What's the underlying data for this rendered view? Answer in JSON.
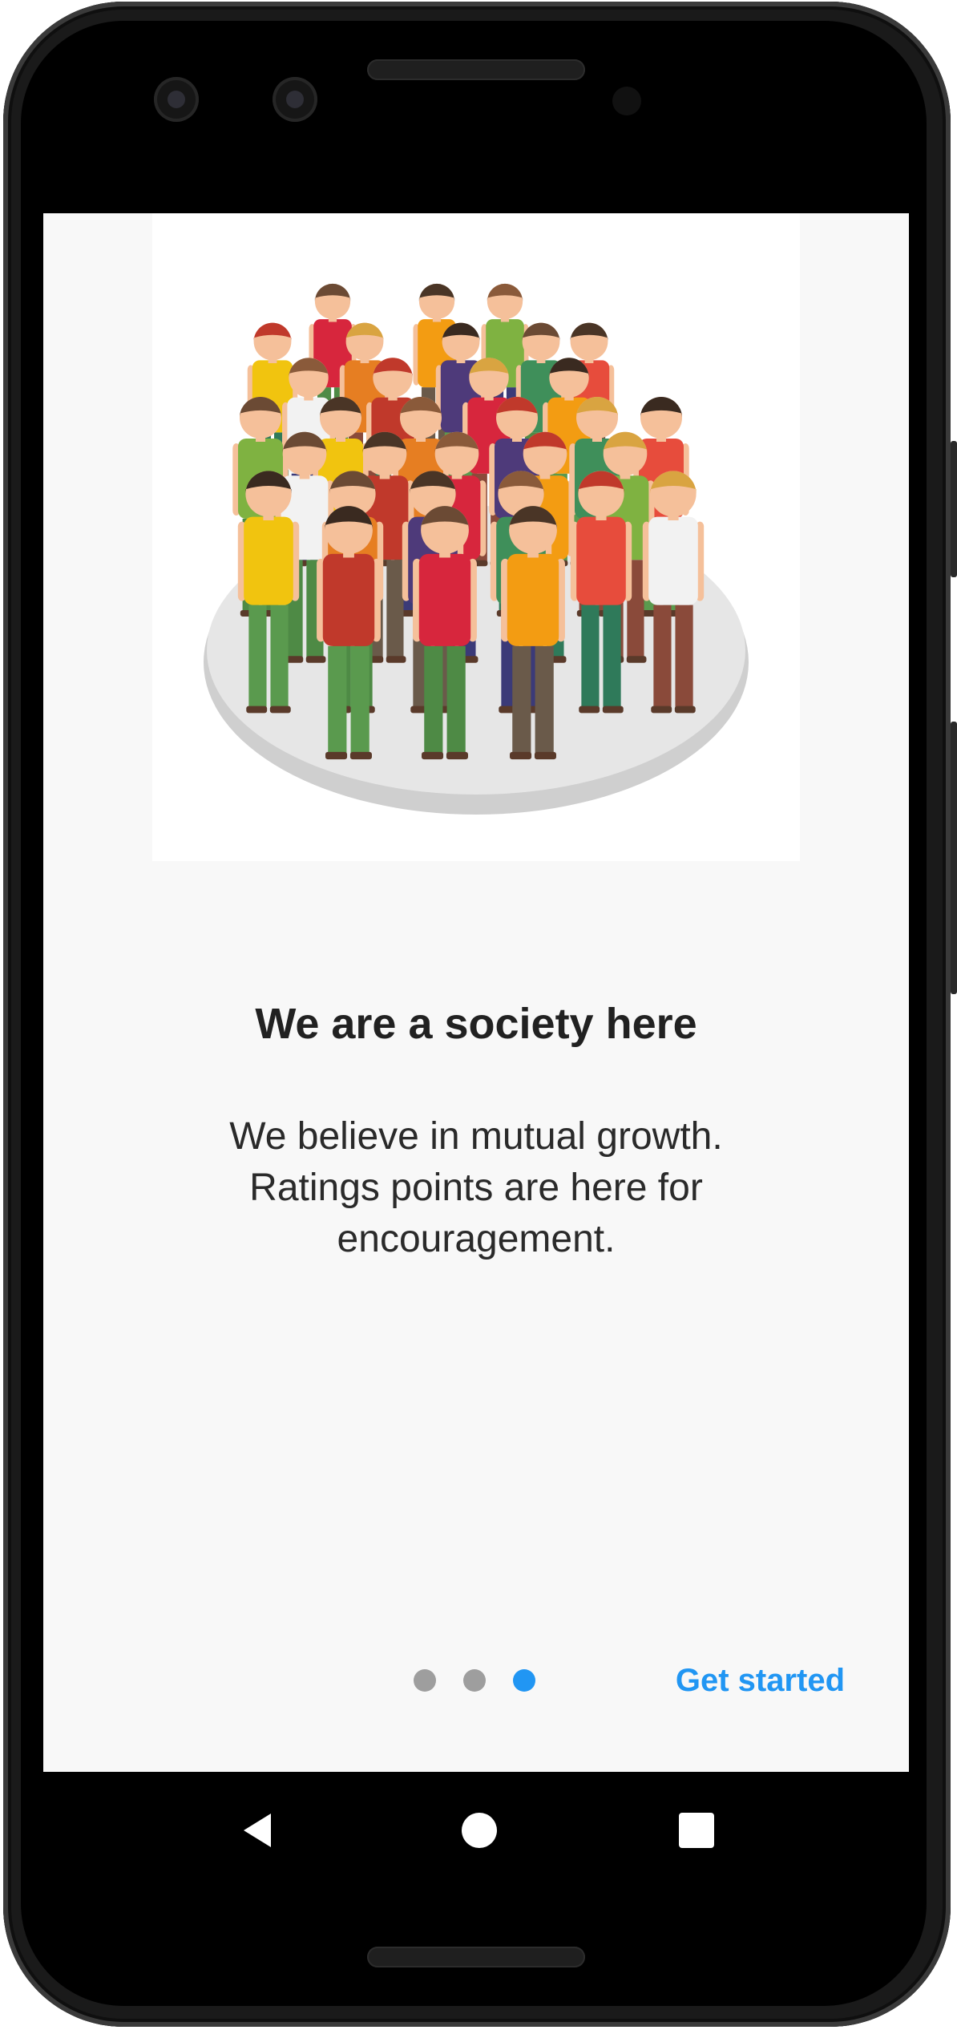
{
  "onboarding": {
    "title": "We are a society here",
    "description": "We believe in mutual growth. Ratings points are here for encouragement.",
    "page_indicator": {
      "count": 3,
      "active_index": 2,
      "active_color": "#2196f3",
      "inactive_color": "#9e9e9e"
    },
    "cta_label": "Get started",
    "hero_image": "crowd-of-people-illustration"
  },
  "navigation_bar": {
    "back": "back-icon",
    "home": "home-icon",
    "recents": "recents-icon"
  },
  "colors": {
    "accent": "#2196f3",
    "text_primary": "#212121",
    "background": "#f8f8f8"
  }
}
